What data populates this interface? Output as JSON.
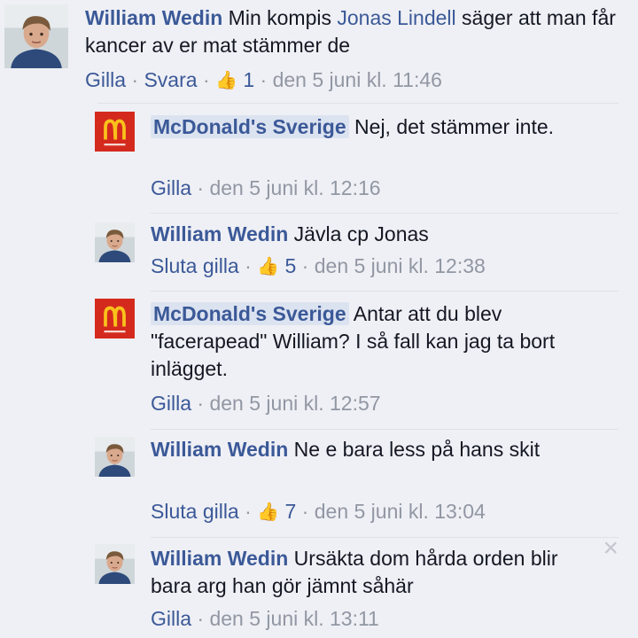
{
  "comments": [
    {
      "author": "William Wedin",
      "avatar_icon": "user-avatar-icon",
      "text_pre": "Min kompis",
      "text_link": "Jonas Lindell",
      "text_post": "säger att man får kancer av er mat stämmer de",
      "actions": [
        "Gilla",
        "Svara"
      ],
      "likes": "1",
      "timestamp": "den 5 juni kl. 11:46"
    },
    {
      "author": "McDonald's Sverige",
      "avatar_icon": "mcdonalds-logo-icon",
      "text": "Nej, det stämmer inte.",
      "actions": [
        "Gilla"
      ],
      "timestamp": "den 5 juni kl. 12:16"
    },
    {
      "author": "William Wedin",
      "avatar_icon": "user-avatar-icon",
      "text": "Jävla cp Jonas",
      "actions": [
        "Sluta gilla"
      ],
      "likes": "5",
      "timestamp": "den 5 juni kl. 12:38"
    },
    {
      "author": "McDonald's Sverige",
      "avatar_icon": "mcdonalds-logo-icon",
      "text": "Antar att du blev \"facerapead\" William? I så fall kan jag ta bort inlägget.",
      "actions": [
        "Gilla"
      ],
      "timestamp": "den 5 juni kl. 12:57"
    },
    {
      "author": "William Wedin",
      "avatar_icon": "user-avatar-icon",
      "text": "Ne e bara less på hans skit",
      "actions": [
        "Sluta gilla"
      ],
      "likes": "7",
      "timestamp": "den 5 juni kl. 13:04"
    },
    {
      "author": "William Wedin",
      "avatar_icon": "user-avatar-icon",
      "text": "Ursäkta dom hårda orden blir bara arg han gör jämnt såhär",
      "actions": [
        "Gilla"
      ],
      "timestamp": "den 5 juni kl. 13:11"
    }
  ],
  "close_icon": "×",
  "like_icon": "👍",
  "separator_dot": "·",
  "colors": {
    "background": "#eff0f5",
    "author_blue": "#3b5998",
    "meta_grey": "#9197a3",
    "mcdonalds_red": "#d42a1e",
    "mcdonalds_yellow": "#f9c21b"
  }
}
